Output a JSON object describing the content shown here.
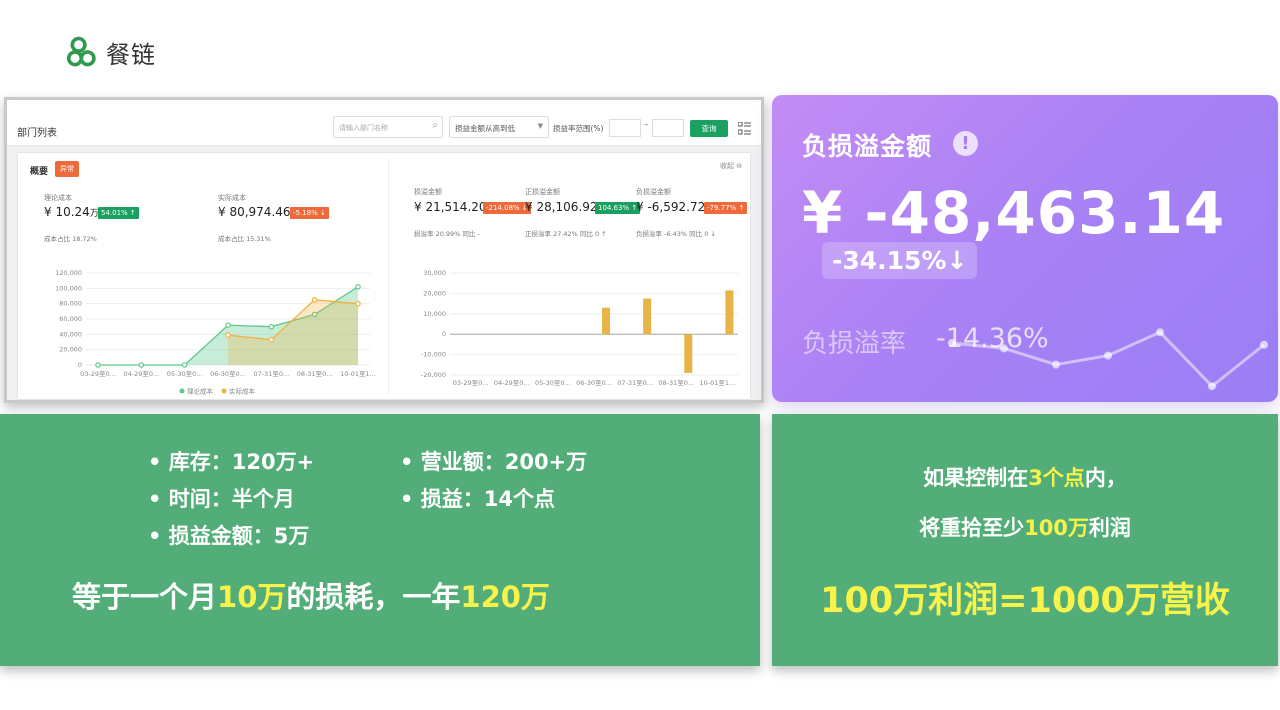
{
  "logo": {
    "text": "餐链"
  },
  "screenshot": {
    "dept_title": "部门列表",
    "search_placeholder": "请输入部门名称",
    "sort_label": "损益金额从高到低",
    "range_label": "损益率范围(%)",
    "range_dash": "–",
    "query_label": "查询",
    "overview_title": "概要",
    "abnormal_badge": "异常",
    "collapse_label": "收起 ⊖",
    "kpis": [
      {
        "label": "理论成本",
        "value": "¥ 10.24",
        "unit": "万",
        "pill": "54.01% ↑",
        "pill_color": "green",
        "sub": "成本占比  18.72%"
      },
      {
        "label": "实际成本",
        "value": "¥ 80,974.46",
        "unit": "",
        "pill": "-5.18% ↓",
        "pill_color": "orange",
        "sub": "成本占比  15.31%"
      },
      {
        "label": "损溢金额",
        "value": "¥ 21,514.20",
        "unit": "",
        "pill": "-214.08% ↓",
        "pill_color": "orange",
        "sub": "损溢率  20.99%    同比  -"
      },
      {
        "label": "正损溢金额",
        "value": "¥ 28,106.92",
        "unit": "",
        "pill": "104.63% ↑",
        "pill_color": "green",
        "sub": "正损溢率  27.42%    同比  0 ↑"
      },
      {
        "label": "负损溢金额",
        "value": "¥ -6,592.72",
        "unit": "",
        "pill": "-79.77% ↑",
        "pill_color": "orange",
        "sub": "负损溢率  -6.43%    同比  0 ↓"
      }
    ],
    "legend": {
      "theory": "理论成本",
      "actual": "实际成本"
    },
    "colors": {
      "theory": "#5ec98b",
      "actual": "#f3b13c",
      "bar": "#e7b447"
    }
  },
  "chart_data": [
    {
      "type": "area",
      "categories": [
        "03-29至0...",
        "04-29至0...",
        "05-30至0...",
        "06-30至0...",
        "07-31至0...",
        "08-31至0...",
        "10-01至1..."
      ],
      "series": [
        {
          "name": "理论成本",
          "values": [
            0,
            0,
            0,
            52000,
            50000,
            66000,
            102000
          ]
        },
        {
          "name": "实际成本",
          "values": [
            null,
            null,
            null,
            39000,
            33000,
            85000,
            80000
          ]
        }
      ],
      "yticks": [
        0,
        20000,
        40000,
        60000,
        80000,
        100000,
        120000
      ],
      "ytick_labels": [
        "0",
        "20,000",
        "40,000",
        "60,000",
        "80,000",
        "100,000",
        "120,000"
      ],
      "ylim": [
        0,
        120000
      ],
      "legend": "bottom"
    },
    {
      "type": "bar",
      "categories": [
        "03-29至0...",
        "04-29至0...",
        "05-30至0...",
        "06-30至0...",
        "07-31至0...",
        "08-31至0...",
        "10-01至1..."
      ],
      "values": [
        0,
        0,
        0,
        13000,
        17500,
        -19000,
        21500
      ],
      "yticks": [
        -20000,
        -10000,
        0,
        10000,
        20000,
        30000
      ],
      "ytick_labels": [
        "-20,000",
        "-10,000",
        "0",
        "10,000",
        "20,000",
        "30,000"
      ],
      "ylim": [
        -20000,
        30000
      ]
    }
  ],
  "purple_card": {
    "title": "负损溢金额",
    "info_icon": "!",
    "amount": "¥ -48,463.14",
    "change": "-34.15%↓",
    "rate_label": "负损溢率",
    "rate_value": "-14.36%",
    "spark_values": [
      3,
      2.7,
      1.8,
      2.3,
      3.6,
      0.6,
      2.9
    ]
  },
  "green_left": {
    "bullets": [
      "库存：120万+",
      "营业额：200+万",
      "时间：半个月",
      "损益：14个点",
      "损益金额：5万"
    ],
    "summary_parts": [
      "等于一个月",
      "10万",
      "的损耗，一年",
      "120万"
    ]
  },
  "green_right": {
    "line1_parts": [
      "如果控制在",
      "3个点",
      "内，"
    ],
    "line2_parts": [
      "将重拾至少",
      "100万",
      "利润"
    ],
    "big": "100万利润=1000万营收"
  }
}
